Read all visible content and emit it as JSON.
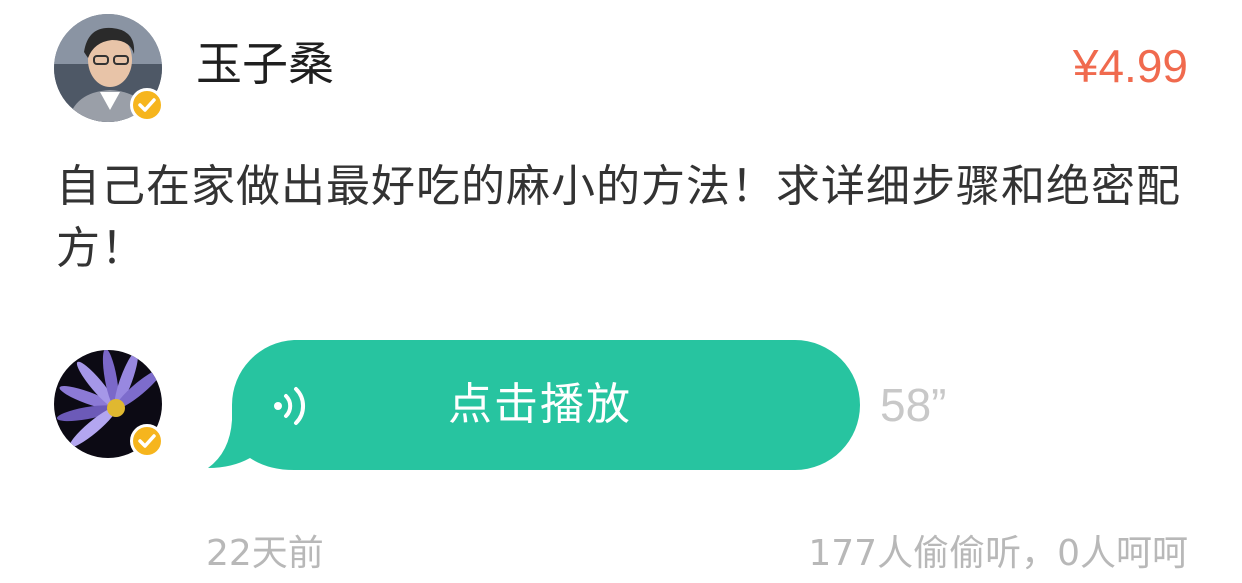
{
  "question": {
    "asker_name": "玉子桑",
    "price": "¥4.99",
    "text": "自己在家做出最好吃的麻小的方法！求详细步骤和绝密配方！"
  },
  "answer": {
    "play_label": "点击播放",
    "duration": "58”",
    "time_ago": "22天前",
    "listen_stats": "177人偷偷听，0人呵呵"
  },
  "colors": {
    "bubble": "#27c4a0",
    "price": "#f06a4e",
    "verified_badge": "#f6b51d",
    "muted_text": "#b8b8b8"
  },
  "icons": {
    "verified": "checkmark-badge-icon",
    "sound": "sound-wave-icon"
  }
}
